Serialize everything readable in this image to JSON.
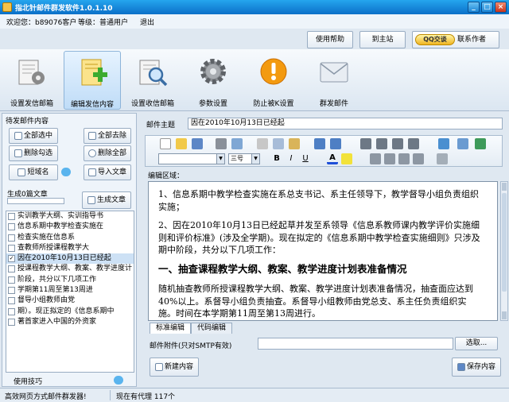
{
  "window": {
    "title": "指北针邮件群发软件1.0.1.10",
    "minimize": "_",
    "maximize": "□",
    "close": "×"
  },
  "userbar": {
    "welcome": "欢迎您：b89076客户",
    "level": "等级：普通用户",
    "logout": "退出"
  },
  "topbuttons": {
    "help": "使用帮助",
    "home": "到主站",
    "qq_badge": "QQ交谈",
    "contact": "联系作者"
  },
  "nav": [
    {
      "label": "设置发信邮箱",
      "icon": "mail-settings-icon"
    },
    {
      "label": "编辑发信内容",
      "icon": "edit-content-icon"
    },
    {
      "label": "设置收信邮箱",
      "icon": "search-mailbox-icon"
    },
    {
      "label": "参数设置",
      "icon": "gear-icon"
    },
    {
      "label": "防止被K设置",
      "icon": "warning-icon"
    },
    {
      "label": "群发邮件",
      "icon": "envelope-icon"
    }
  ],
  "left": {
    "header": "待发邮件内容",
    "buttons": {
      "select_all": "全部选中",
      "remove_all": "全部去除",
      "delete_checked": "删除勾选",
      "delete_all": "删除全部",
      "short_name": "短域名",
      "import": "导入文章",
      "generate": "生成文章"
    },
    "generated": "生成0篇文章",
    "items": [
      {
        "text": "实训教学大纲、实训指导书",
        "checked": false,
        "selected": false
      },
      {
        "text": "信息系期中教学检查实施在",
        "checked": false,
        "selected": false
      },
      {
        "text": "检查实施在信息系",
        "checked": false,
        "selected": false
      },
      {
        "text": "查教师所授课程教学大",
        "checked": false,
        "selected": false
      },
      {
        "text": "因在2010年10月13日已经起",
        "checked": true,
        "selected": true
      },
      {
        "text": "授课程教学大纲、教案、教学进度计",
        "checked": false,
        "selected": false
      },
      {
        "text": "阶段，共分以下几项工作",
        "checked": false,
        "selected": false
      },
      {
        "text": "学期第11周至第13周进",
        "checked": false,
        "selected": false
      },
      {
        "text": "督导小组教师由党",
        "checked": false,
        "selected": false
      },
      {
        "text": "期）。现正拟定的《信息系期中",
        "checked": false,
        "selected": false
      },
      {
        "text": "著首家进入中国的外资家",
        "checked": false,
        "selected": false
      }
    ],
    "tips": "使用技巧"
  },
  "right": {
    "subject_label": "邮件主题",
    "subject_value": "因在2010年10月13日已经起",
    "editor_label": "编辑区域：",
    "font_size": "三号",
    "font_name": "",
    "style_name": "",
    "content": {
      "p1": "1、信息系期中教学检查实施在系总支书记、系主任领导下，教学督导小组负责组织实施；",
      "p2": "2、因在2010年10月13日已经起草并发至系领导《信息系教师课内教学评价实施细则和评价标准》(涉及全学期)。现在拟定的《信息系期中教学检查实施细则》只涉及期中阶段，共分以下几项工作：",
      "h": "一、抽查课程教学大纲、教案、教学进度计划表准备情况",
      "p3": "随机抽查教师所授课程教学大纲、教案、教学进度计划表准备情况，抽查面应达到40%以上。系督导小组负责抽查。系督导小组教师由党总支、系主任负责组织实施。时间在本学期第11周至第13周进行。"
    },
    "tabs": [
      "标准编辑",
      "代码编辑"
    ],
    "attach_label": "邮件附件(只对SMTP有效)",
    "attach_value": "",
    "browse": "选取...",
    "new_content": "新建内容",
    "save_content": "保存内容"
  },
  "status": {
    "left": "高效网页方式邮件群发器!",
    "right": "现在有代理 117个"
  },
  "colors": {
    "title_blue": "#0b6fc8",
    "panel_bg": "#eef4fa",
    "border": "#98acc2"
  }
}
